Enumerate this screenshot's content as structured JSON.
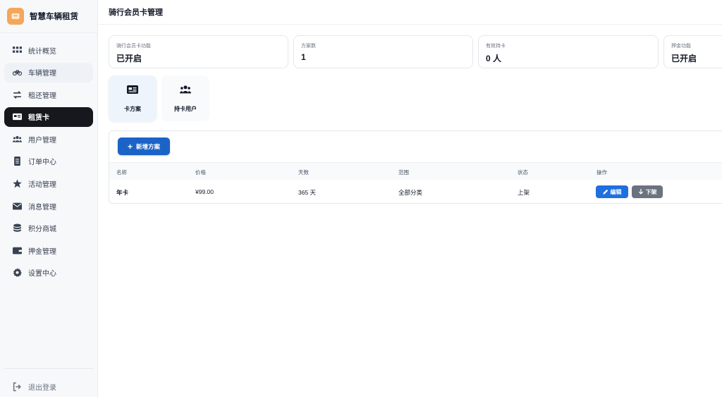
{
  "app": {
    "name": "智慧车辆租赁"
  },
  "sidebar": {
    "items": [
      {
        "label": "统计概览",
        "icon": "grid-icon"
      },
      {
        "label": "车辆管理",
        "icon": "bicycle-icon"
      },
      {
        "label": "租还管理",
        "icon": "exchange-icon"
      },
      {
        "label": "租赁卡",
        "icon": "id-card-icon"
      },
      {
        "label": "用户管理",
        "icon": "users-icon"
      },
      {
        "label": "订单中心",
        "icon": "receipt-icon"
      },
      {
        "label": "活动管理",
        "icon": "star-icon"
      },
      {
        "label": "消息管理",
        "icon": "envelope-icon"
      },
      {
        "label": "积分商城",
        "icon": "coins-icon"
      },
      {
        "label": "押金管理",
        "icon": "wallet-icon"
      },
      {
        "label": "设置中心",
        "icon": "gear-icon"
      }
    ],
    "logout": {
      "label": "退出登录",
      "icon": "logout-icon"
    }
  },
  "header": {
    "title": "骑行会员卡管理"
  },
  "stats": [
    {
      "label": "骑行会员卡功能",
      "value": "已开启"
    },
    {
      "label": "方案数",
      "value": "1"
    },
    {
      "label": "有效持卡",
      "value": "0 人"
    },
    {
      "label": "押金功能",
      "value": "已开启"
    }
  ],
  "tabs": [
    {
      "label": "卡方案",
      "icon": "id-card-icon"
    },
    {
      "label": "持卡用户",
      "icon": "users-icon"
    }
  ],
  "toolbar": {
    "add_label": "新增方案"
  },
  "table": {
    "columns": [
      "名称",
      "价格",
      "天数",
      "范围",
      "状态",
      "操作"
    ],
    "rows": [
      {
        "name": "年卡",
        "price": "¥99.00",
        "days": "365 天",
        "scope": "全部分类",
        "status": "上架",
        "edit": "编辑",
        "offshelf": "下架"
      }
    ]
  },
  "colors": {
    "active_nav": "#16181d",
    "primary": "#1b63c7",
    "edit": "#1f6fe0",
    "offshelf": "#6b7280",
    "brand": "#f5a65b"
  }
}
